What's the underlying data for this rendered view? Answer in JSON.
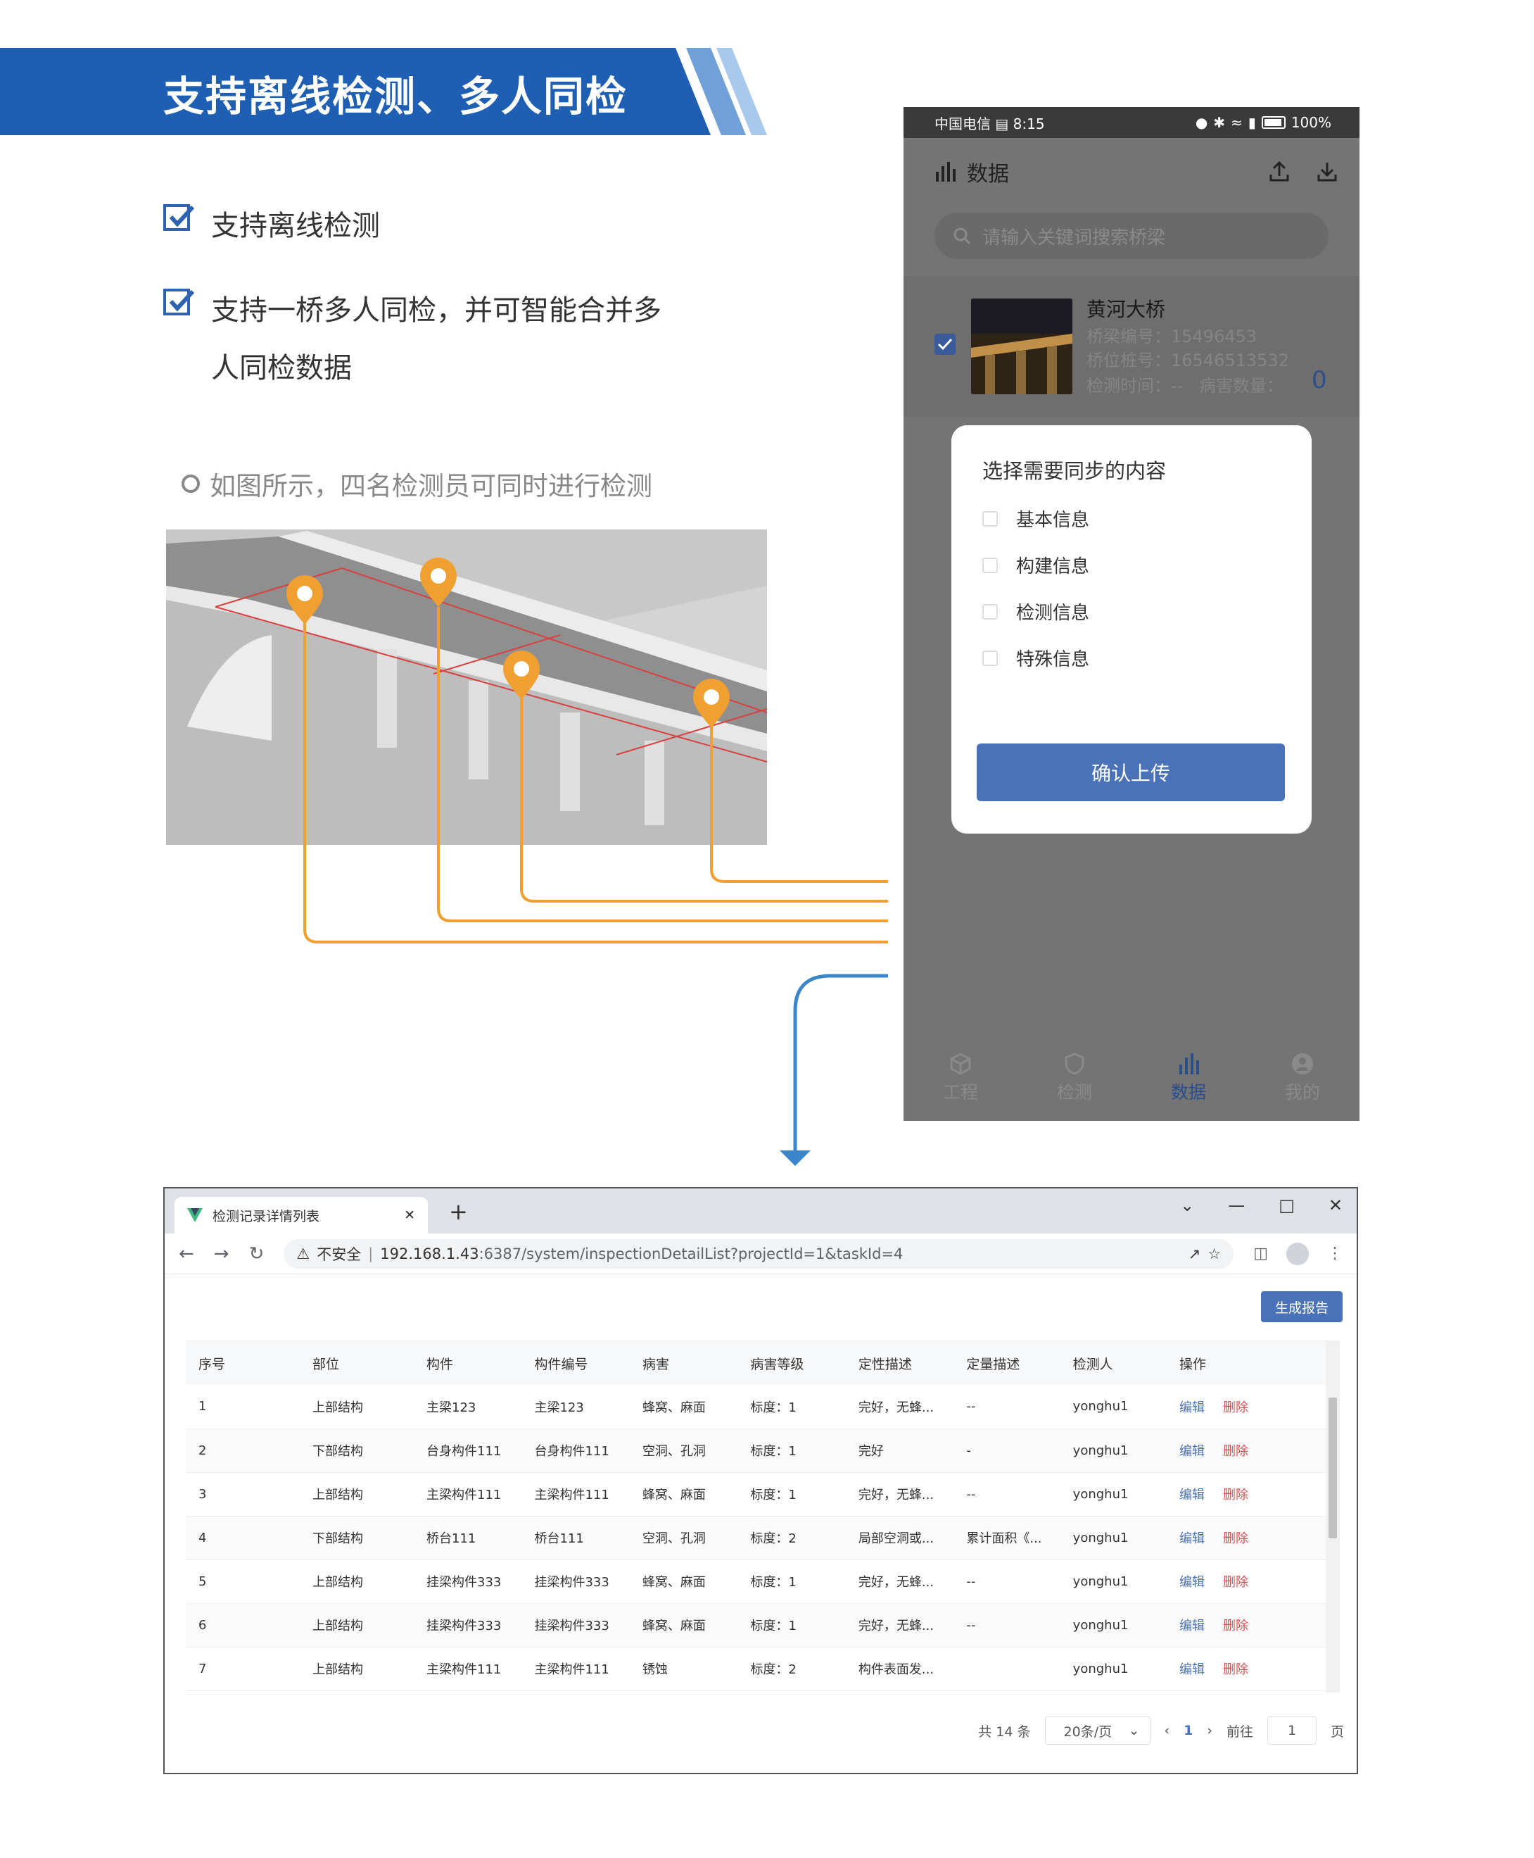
{
  "banner": {
    "title": "支持离线检测、多人同检"
  },
  "features": [
    {
      "text": "支持离线检测"
    },
    {
      "text": "支持一桥多人同检，并可智能合并多"
    },
    {
      "text": "人同检数据"
    }
  ],
  "caption": "如图所示，四名检测员可同时进行检测",
  "phone": {
    "status": {
      "carrier": "中国电信",
      "time": "8:15",
      "battery": "100%"
    },
    "header_title": "数据",
    "search_placeholder": "请输入关键词搜索桥梁",
    "card": {
      "name": "黄河大桥",
      "bridge_no": "桥梁编号：15496453",
      "station_no": "桥位桩号：16546513532",
      "inspect_time": "检测时间：--",
      "defect_label": "病害数量：",
      "defect_count": "0"
    },
    "modal": {
      "title": "选择需要同步的内容",
      "options": [
        "基本信息",
        "构建信息",
        "检测信息",
        "特殊信息"
      ],
      "confirm": "确认上传"
    },
    "tabs": [
      "工程",
      "检测",
      "数据",
      "我的"
    ],
    "active_tab": "数据"
  },
  "browser": {
    "tab_title": "检测记录详情列表",
    "insecure": "不安全",
    "url_host": "192.168.1.43",
    "url_rest": ":6387/system/inspectionDetailList?projectId=1&taskId=4",
    "report_button": "生成报告",
    "columns": [
      "序号",
      "部位",
      "构件",
      "构件编号",
      "病害",
      "病害等级",
      "定性描述",
      "定量描述",
      "检测人",
      "操作"
    ],
    "rows": [
      [
        "1",
        "上部结构",
        "主梁123",
        "主梁123",
        "蜂窝、麻面",
        "标度：1",
        "完好，无蜂...",
        "--",
        "yonghu1"
      ],
      [
        "2",
        "下部结构",
        "台身构件111",
        "台身构件111",
        "空洞、孔洞",
        "标度：1",
        "完好",
        "-",
        "yonghu1"
      ],
      [
        "3",
        "上部结构",
        "主梁构件111",
        "主梁构件111",
        "蜂窝、麻面",
        "标度：1",
        "完好，无蜂...",
        "--",
        "yonghu1"
      ],
      [
        "4",
        "下部结构",
        "桥台111",
        "桥台111",
        "空洞、孔洞",
        "标度：2",
        "局部空洞或...",
        "累计面积《...",
        "yonghu1"
      ],
      [
        "5",
        "上部结构",
        "挂梁构件333",
        "挂梁构件333",
        "蜂窝、麻面",
        "标度：1",
        "完好，无蜂...",
        "--",
        "yonghu1"
      ],
      [
        "6",
        "上部结构",
        "挂梁构件333",
        "挂梁构件333",
        "蜂窝、麻面",
        "标度：1",
        "完好，无蜂...",
        "--",
        "yonghu1"
      ],
      [
        "7",
        "上部结构",
        "主梁构件111",
        "主梁构件111",
        "锈蚀",
        "标度：2",
        "构件表面发...",
        "",
        "yonghu1"
      ]
    ],
    "op_edit": "编辑",
    "op_delete": "删除",
    "pagination": {
      "total": "共 14 条",
      "page_size": "20条/页",
      "current_page": "1",
      "goto_label": "前往",
      "goto_value": "1",
      "page_suffix": "页"
    }
  },
  "colors": {
    "brand_blue": "#1e5fb4",
    "accent_orange": "#f0a030",
    "arrow_blue": "#3a86c8",
    "button_blue": "#4a72b8",
    "delete_red": "#d65252"
  }
}
